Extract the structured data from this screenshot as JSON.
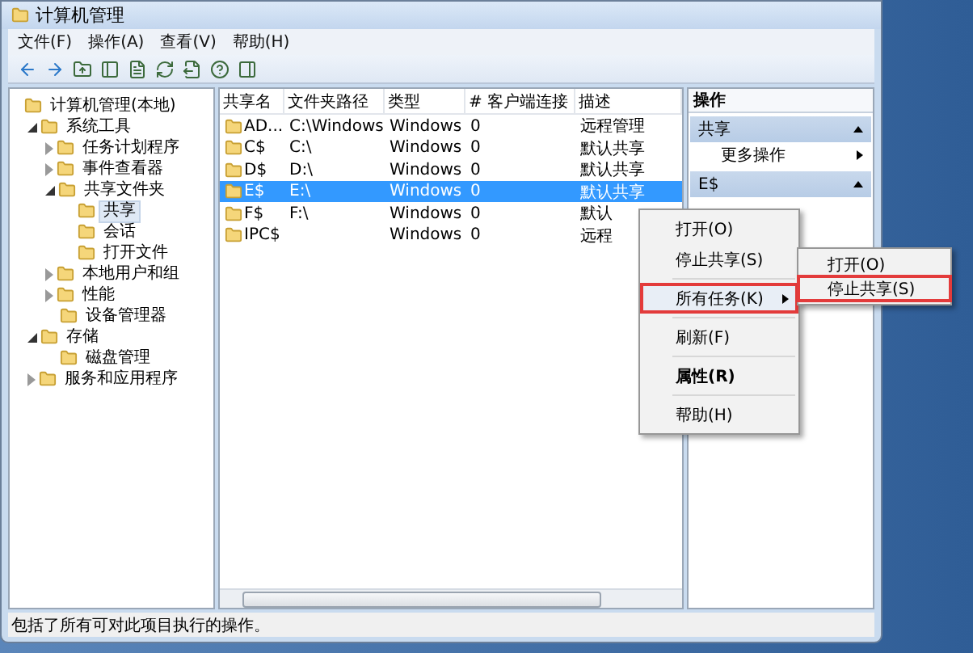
{
  "window": {
    "title": "计算机管理"
  },
  "menu_bar": [
    "文件(F)",
    "操作(A)",
    "查看(V)",
    "帮助(H)"
  ],
  "tree": [
    {
      "label": "计算机管理(本地)",
      "selected": false,
      "children": [
        {
          "label": "系统工具",
          "expanded": true,
          "selected": false,
          "children": [
            {
              "label": "任务计划程序",
              "expanded": false,
              "selected": false
            },
            {
              "label": "事件查看器",
              "expanded": false,
              "selected": false
            },
            {
              "label": "共享文件夹",
              "expanded": true,
              "selected": false,
              "children": [
                {
                  "label": "共享",
                  "selected": true
                },
                {
                  "label": "会话",
                  "selected": false
                },
                {
                  "label": "打开文件",
                  "selected": false
                }
              ]
            },
            {
              "label": "本地用户和组",
              "expanded": false,
              "selected": false
            },
            {
              "label": "性能",
              "expanded": false,
              "selected": false
            },
            {
              "label": "设备管理器",
              "selected": false
            }
          ]
        },
        {
          "label": "存储",
          "expanded": true,
          "selected": false,
          "children": [
            {
              "label": "磁盘管理",
              "selected": false
            }
          ]
        },
        {
          "label": "服务和应用程序",
          "expanded": false,
          "selected": false
        }
      ]
    }
  ],
  "table": {
    "columns": [
      "共享名",
      "文件夹路径",
      "类型",
      "# 客户端连接",
      "描述"
    ],
    "rows": [
      {
        "cells": [
          "AD...",
          "C:\\Windows",
          "Windows",
          "0",
          "远程管理"
        ],
        "selected": false
      },
      {
        "cells": [
          "C$",
          "C:\\",
          "Windows",
          "0",
          "默认共享"
        ],
        "selected": false
      },
      {
        "cells": [
          "D$",
          "D:\\",
          "Windows",
          "0",
          "默认共享"
        ],
        "selected": false
      },
      {
        "cells": [
          "E$",
          "E:\\",
          "Windows",
          "0",
          "默认共享"
        ],
        "selected": true
      },
      {
        "cells": [
          "F$",
          "F:\\",
          "Windows",
          "0",
          "默认"
        ],
        "selected": false
      },
      {
        "cells": [
          "IPC$",
          "",
          "Windows",
          "0",
          "远程"
        ],
        "selected": false
      }
    ]
  },
  "actions": {
    "title": "操作",
    "sections": [
      {
        "title": "共享",
        "items": [
          "更多操作"
        ]
      },
      {
        "title": "E$"
      }
    ]
  },
  "context_menu": [
    {
      "kind": "item",
      "label": "打开(O)"
    },
    {
      "kind": "item",
      "label": "停止共享(S)"
    },
    {
      "kind": "separator"
    },
    {
      "kind": "submenu",
      "label": "所有任务(K)",
      "highlighted": true
    },
    {
      "kind": "separator"
    },
    {
      "kind": "item",
      "label": "刷新(F)"
    },
    {
      "kind": "separator"
    },
    {
      "kind": "default",
      "label": "属性(R)"
    },
    {
      "kind": "separator"
    },
    {
      "kind": "item",
      "label": "帮助(H)"
    }
  ],
  "submenu": [
    {
      "label": "打开(O)",
      "highlighted": false
    },
    {
      "label": "停止共享(S)",
      "highlighted": true
    }
  ],
  "status_bar": "包括了所有可对此项目执行的操作。"
}
